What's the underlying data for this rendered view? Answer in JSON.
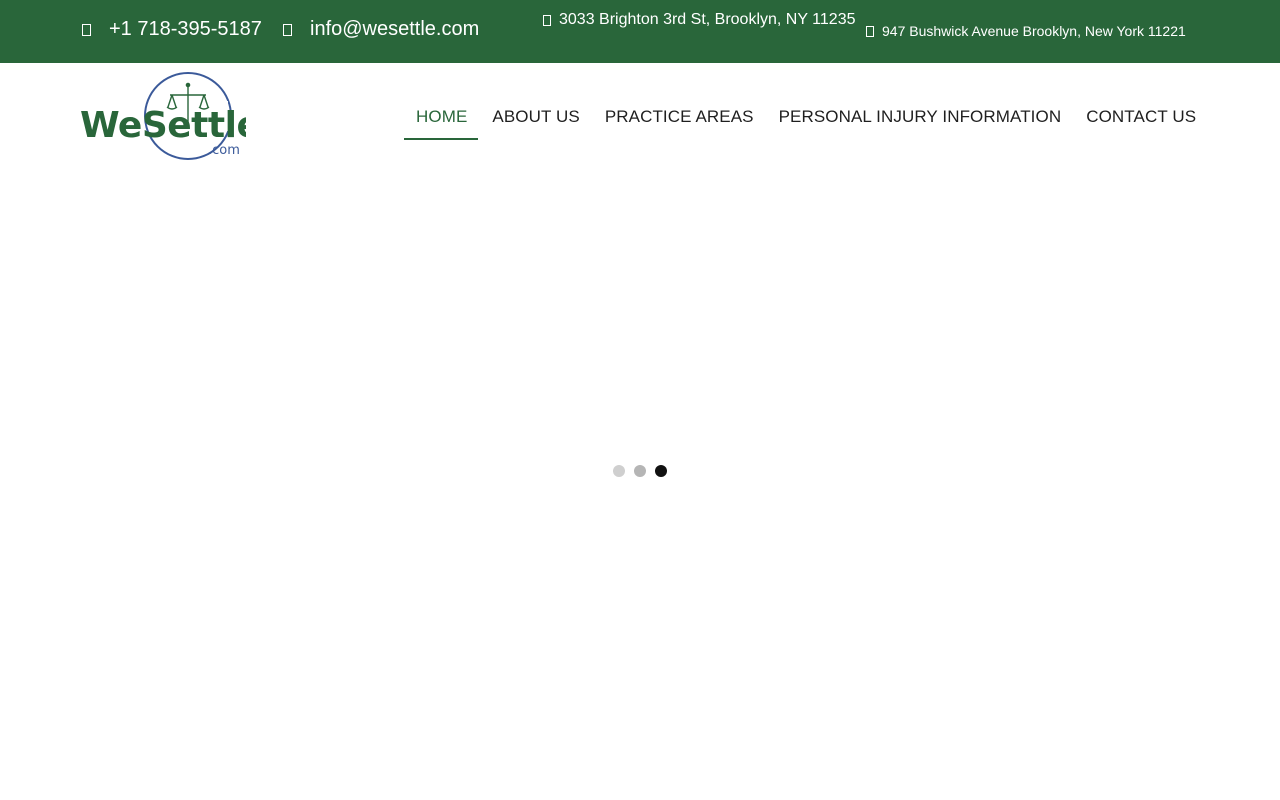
{
  "topbar": {
    "phone": "+1 718-395-5187",
    "phone_icon": "phone-icon",
    "email": "info@wesettle.com",
    "email_icon": "envelope-icon",
    "address_primary": "3033 Brighton 3rd St, Brooklyn, NY 11235",
    "address_primary_icon": "location-pin-icon",
    "address_secondary": "947 Bushwick Avenue Brooklyn, New York 11221",
    "address_secondary_icon": "location-pin-icon"
  },
  "logo": {
    "wordmark": "WeSettle",
    "suffix": ".com"
  },
  "nav": {
    "items": [
      {
        "label": "HOME",
        "active": true
      },
      {
        "label": "ABOUT US",
        "active": false
      },
      {
        "label": "PRACTICE AREAS",
        "active": false
      },
      {
        "label": "PERSONAL INJURY INFORMATION",
        "active": false
      },
      {
        "label": "CONTACT US",
        "active": false
      }
    ]
  },
  "loader": {
    "dots": 3,
    "active_dot": 3
  },
  "colors": {
    "brand_green": "#29663a",
    "logo_blue": "#3b5a9a",
    "text_dark": "#1f1f1f",
    "dot_light": "#cfcfcf",
    "dot_mid": "#b5b5b5",
    "dot_active": "#111111"
  }
}
